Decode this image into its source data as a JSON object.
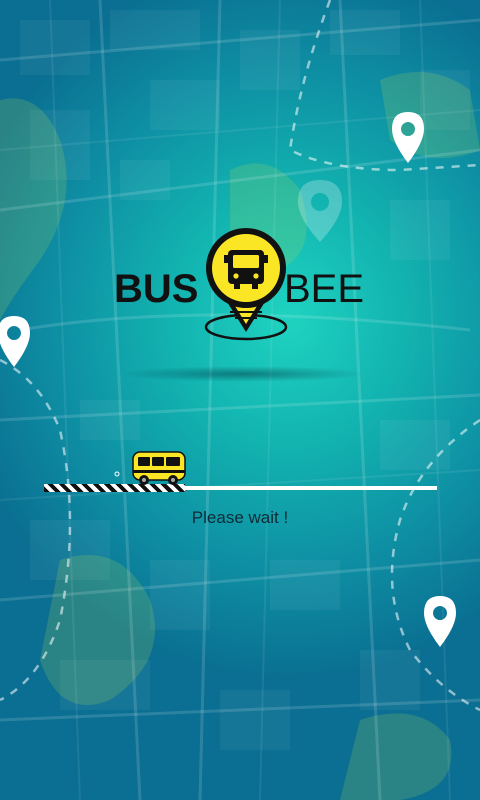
{
  "app": {
    "brand_left": "BUS",
    "brand_right": "BEE"
  },
  "loading": {
    "progress": 0.36,
    "message": "Please wait !"
  },
  "colors": {
    "accent_yellow": "#fbe625",
    "brand_black": "#111111",
    "bg_teal": "#14b7b0",
    "bg_deep": "#0a6f92"
  },
  "icons": [
    "location-pin-icon",
    "bus-icon"
  ]
}
